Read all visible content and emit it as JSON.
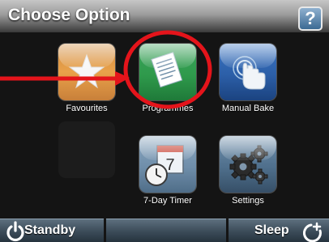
{
  "header": {
    "title": "Choose Option",
    "help_label": "?"
  },
  "tiles": [
    {
      "label": "Favourites",
      "icon": "star-icon",
      "color": "#e9a14a"
    },
    {
      "label": "Programmes",
      "icon": "document-icon",
      "color": "#2f9a4c"
    },
    {
      "label": "Manual Bake",
      "icon": "hand-touch-icon",
      "color": "#2c5fa8"
    },
    {
      "label": "7-Day Timer",
      "icon": "calendar-clock-icon",
      "color": "#6f8eaa"
    },
    {
      "label": "Settings",
      "icon": "gears-icon",
      "color": "#4f6f8c"
    }
  ],
  "footer": {
    "standby_label": "Standby",
    "sleep_label": "Sleep"
  },
  "calendar_day": "7",
  "colors": {
    "highlight": "#e4141b",
    "background": "#141414"
  }
}
